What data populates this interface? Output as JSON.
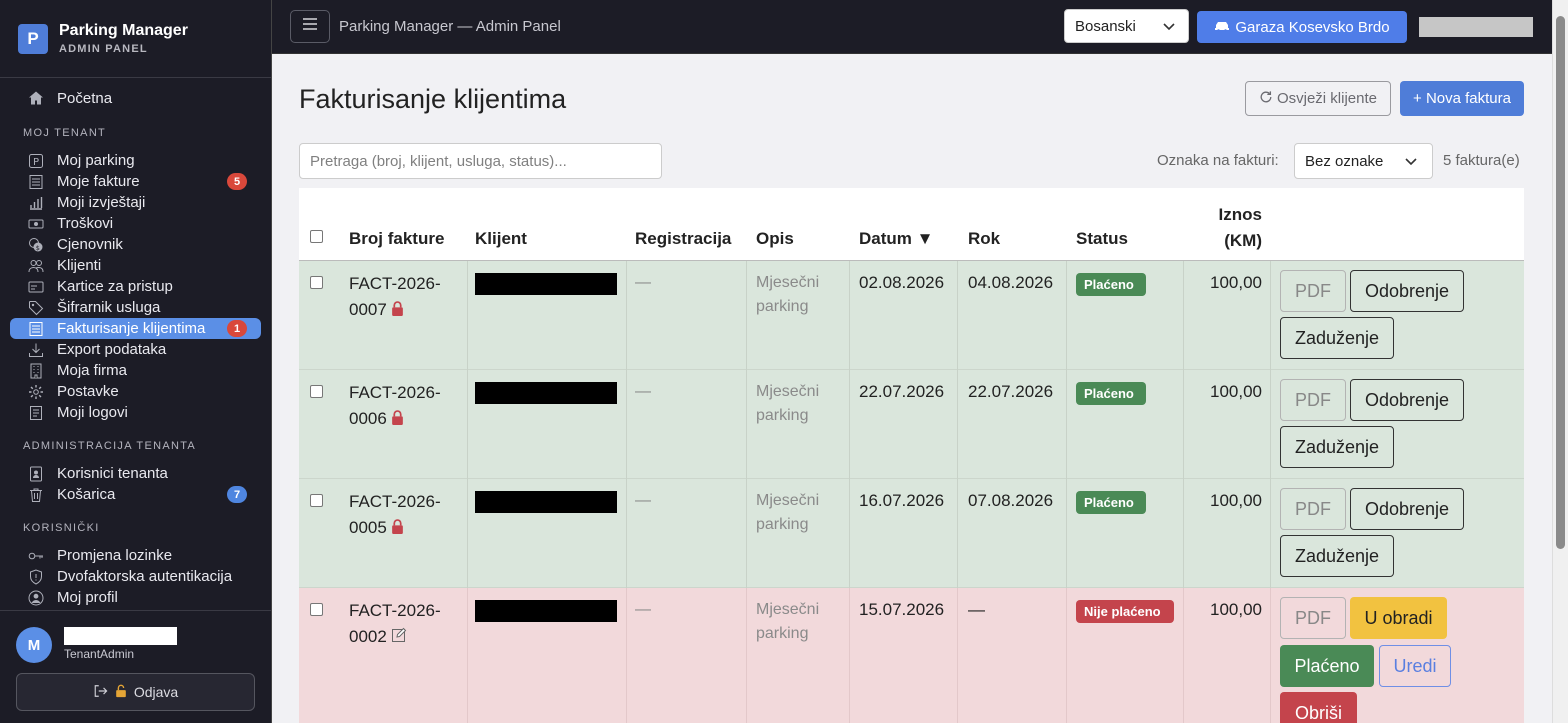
{
  "brand": {
    "logo_letter": "P",
    "title": "Parking Manager",
    "subtitle": "ADMIN PANEL"
  },
  "sidebar": {
    "home": {
      "label": "Početna"
    },
    "sections": [
      {
        "title": "MOJ TENANT",
        "items": [
          {
            "label": "Moj parking",
            "icon": "parking-icon"
          },
          {
            "label": "Moje fakture",
            "icon": "invoice-icon",
            "badge": "5"
          },
          {
            "label": "Moji izvještaji",
            "icon": "bar-chart-icon"
          },
          {
            "label": "Troškovi",
            "icon": "cash-icon"
          },
          {
            "label": "Cjenovnik",
            "icon": "coins-icon"
          },
          {
            "label": "Klijenti",
            "icon": "people-icon"
          },
          {
            "label": "Kartice za pristup",
            "icon": "card-icon"
          },
          {
            "label": "Šifrarnik usluga",
            "icon": "tag-icon"
          },
          {
            "label": "Fakturisanje klijentima",
            "icon": "receipt-icon",
            "badge": "1",
            "active": true
          },
          {
            "label": "Export podataka",
            "icon": "download-icon"
          },
          {
            "label": "Moja firma",
            "icon": "building-icon"
          },
          {
            "label": "Postavke",
            "icon": "gear-icon"
          },
          {
            "label": "Moji logovi",
            "icon": "log-icon"
          }
        ]
      },
      {
        "title": "ADMINISTRACIJA TENANTA",
        "items": [
          {
            "label": "Korisnici tenanta",
            "icon": "person-badge-icon"
          },
          {
            "label": "Košarica",
            "icon": "trash-icon",
            "badge": "7"
          }
        ]
      },
      {
        "title": "KORISNIČKI",
        "items": [
          {
            "label": "Promjena lozinke",
            "icon": "key-icon"
          },
          {
            "label": "Dvofaktorska autentikacija",
            "icon": "shield-icon"
          },
          {
            "label": "Moj profil",
            "icon": "user-circle-icon"
          }
        ]
      }
    ],
    "user": {
      "avatar_letter": "M",
      "role": "TenantAdmin",
      "logout_label": "Odjava"
    }
  },
  "topbar": {
    "title": "Parking Manager — Admin Panel",
    "language": "Bosanski",
    "garage_label": "Garaza Kosevsko Brdo"
  },
  "page": {
    "title": "Fakturisanje klijentima",
    "refresh_label": "Osvježi klijente",
    "new_label": "+ Nova faktura",
    "search_placeholder": "Pretraga (broj, klijent, usluga, status)...",
    "tag_label": "Oznaka na fakturi:",
    "tag_value": "Bez oznake",
    "count_label": "5 faktura(e)"
  },
  "table": {
    "headers": {
      "number": "Broj fakture",
      "client": "Klijent",
      "registration": "Registracija",
      "description": "Opis",
      "date": "Datum ▼",
      "due": "Rok",
      "status": "Status",
      "amount_1": "Iznos",
      "amount_2": "(KM)"
    },
    "rows": [
      {
        "number_1": "FACT-2026-",
        "number_2": "0007",
        "icon": "lock-icon",
        "registration": "—",
        "desc_1": "Mjesečni",
        "desc_2": "parking",
        "date": "02.08.2026",
        "due": "04.08.2026",
        "status": "Plaćeno",
        "amount": "100,00",
        "actions": [
          "PDF",
          "Odobrenje",
          "Zaduženje"
        ]
      },
      {
        "number_1": "FACT-2026-",
        "number_2": "0006",
        "icon": "lock-icon",
        "registration": "—",
        "desc_1": "Mjesečni",
        "desc_2": "parking",
        "date": "22.07.2026",
        "due": "22.07.2026",
        "status": "Plaćeno",
        "amount": "100,00",
        "actions": [
          "PDF",
          "Odobrenje",
          "Zaduženje"
        ]
      },
      {
        "number_1": "FACT-2026-",
        "number_2": "0005",
        "icon": "lock-icon",
        "registration": "—",
        "desc_1": "Mjesečni",
        "desc_2": "parking",
        "date": "16.07.2026",
        "due": "07.08.2026",
        "status": "Plaćeno",
        "amount": "100,00",
        "actions": [
          "PDF",
          "Odobrenje",
          "Zaduženje"
        ]
      },
      {
        "number_1": "FACT-2026-",
        "number_2": "0002",
        "icon": "edit-icon",
        "registration": "—",
        "desc_1": "Mjesečni",
        "desc_2": "parking",
        "date": "15.07.2026",
        "due": "—",
        "status": "Nije plaćeno",
        "amount": "100,00",
        "actions": [
          "PDF",
          "U obradi",
          "Plaćeno",
          "Uredi",
          "Obriši"
        ]
      }
    ]
  },
  "colors": {
    "accent": "#4f7dd8",
    "sidebar_bg": "#1c1c26",
    "paid_row": "#dae6dc",
    "unpaid_row": "#f2d9db",
    "paid_badge": "#4a8a56",
    "unpaid_badge": "#c4444c",
    "warning": "#f2c240"
  }
}
